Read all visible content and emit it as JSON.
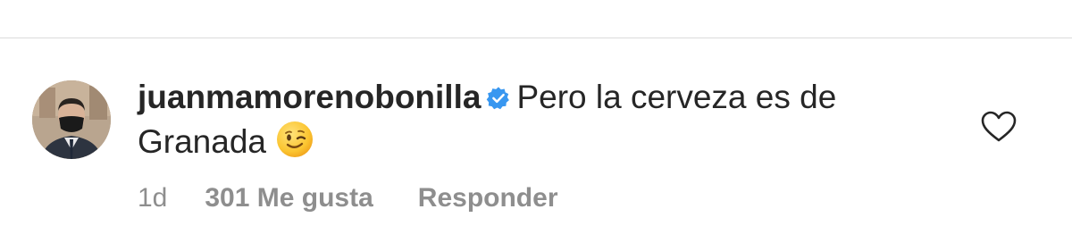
{
  "comment": {
    "username": "juanmamorenobonilla",
    "verified": true,
    "text_line1": "Pero la cerveza es de",
    "text_line2": "Granada",
    "emoji": "winking-face"
  },
  "meta": {
    "time": "1d",
    "likes": "301 Me gusta",
    "reply_label": "Responder"
  },
  "icons": {
    "verified": "verified-badge-icon",
    "like": "heart-icon"
  },
  "colors": {
    "text": "#262626",
    "muted": "#8e8e8e",
    "verified": "#3897f0",
    "divider": "#dbdbdb"
  }
}
